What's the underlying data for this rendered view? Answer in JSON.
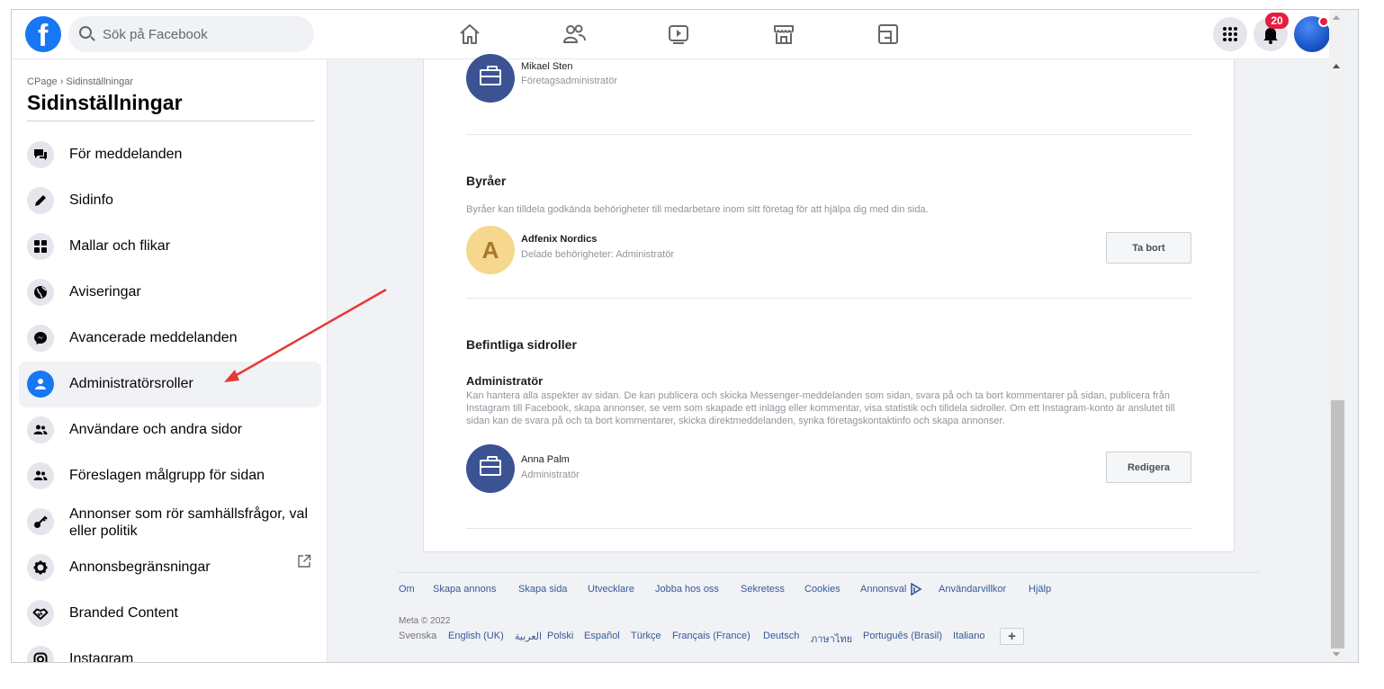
{
  "topbar": {
    "logo_letter": "f",
    "search_placeholder": "Sök på Facebook",
    "nav_icons": [
      "home-icon",
      "friends-icon",
      "watch-icon",
      "marketplace-icon",
      "groups-icon"
    ],
    "notification_count": "20"
  },
  "sidebar": {
    "breadcrumb": "CPage › Sidinställningar",
    "title": "Sidinställningar",
    "items": [
      {
        "label": "För meddelanden",
        "icon": "chat-icon"
      },
      {
        "label": "Sidinfo",
        "icon": "pencil-icon"
      },
      {
        "label": "Mallar och flikar",
        "icon": "grid-icon"
      },
      {
        "label": "Aviseringar",
        "icon": "globe-icon"
      },
      {
        "label": "Avancerade meddelanden",
        "icon": "messenger-icon"
      },
      {
        "label": "Administratörsroller",
        "icon": "person-icon",
        "active": true
      },
      {
        "label": "Användare och andra sidor",
        "icon": "people-icon"
      },
      {
        "label": "Föreslagen målgrupp för sidan",
        "icon": "people-icon"
      },
      {
        "label": "Annonser som rör samhällsfrågor, val eller politik",
        "icon": "key-icon"
      },
      {
        "label": "Annonsbegränsningar",
        "icon": "gear-icon"
      },
      {
        "label": "Branded Content",
        "icon": "handshake-icon"
      },
      {
        "label": "Instagram",
        "icon": "instagram-icon"
      }
    ]
  },
  "main": {
    "top_person": {
      "name": "Mikael Sten",
      "role": "Företagsadministratör"
    },
    "agencies": {
      "title": "Byråer",
      "description": "Byråer kan tilldela godkända behörigheter till medarbetare inom sitt företag för att hjälpa dig med din sida.",
      "agency": {
        "initial": "A",
        "name": "Adfenix Nordics",
        "role": "Delade behörigheter: Administratör"
      },
      "remove_label": "Ta bort"
    },
    "existing_roles": {
      "title": "Befintliga sidroller",
      "role_title": "Administratör",
      "role_description": "Kan hantera alla aspekter av sidan. De kan publicera och skicka Messenger-meddelanden som sidan, svara på och ta bort kommentarer på sidan, publicera från Instagram till Facebook, skapa annonser, se vem som skapade ett inlägg eller kommentar, visa statistik och tilldela sidroller. Om ett Instagram-konto är anslutet till sidan kan de svara på och ta bort kommentarer, skicka direktmeddelanden, synka företagskontaktinfo och skapa annonser.",
      "person": {
        "name": "Anna Palm",
        "role": "Administratör"
      },
      "edit_label": "Redigera"
    }
  },
  "footer": {
    "links": [
      "Om",
      "Skapa annons",
      "Skapa sida",
      "Utvecklare",
      "Jobba hos oss",
      "Sekretess",
      "Cookies",
      "Annonsval",
      "Användarvillkor",
      "Hjälp"
    ],
    "copyright": "Meta © 2022",
    "languages": [
      "Svenska",
      "English (UK)",
      "العربية",
      "Polski",
      "Español",
      "Türkçe",
      "Français (France)",
      "Deutsch",
      "ภาษาไทย",
      "Português (Brasil)",
      "Italiano"
    ],
    "more_languages": "+"
  },
  "colors": {
    "brand": "#1877f2",
    "link": "#385898",
    "annotation_arrow": "#e53935"
  }
}
